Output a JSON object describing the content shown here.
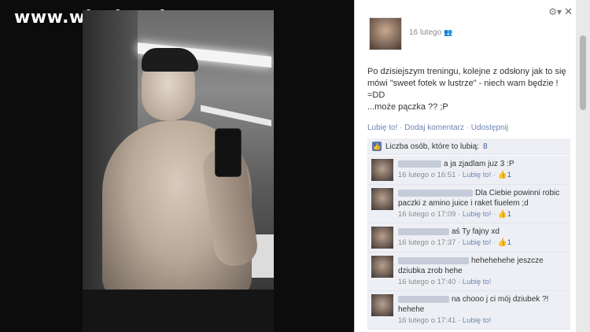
{
  "watermark": "www.wiocha.pl",
  "post": {
    "date": "16 lutego",
    "text_lines": [
      "Po dzisiejszym treningu, kolejne z odsłony jak to się",
      "mówi \"sweet fotek w lustrze\" - niech wam będzie !",
      "=DD",
      "...może pączka ?? ;P"
    ],
    "actions": {
      "like": "Lubię to!",
      "comment": "Dodaj komentarz",
      "share": "Udostępnij",
      "sep": "·"
    },
    "likes_label": "Liczba osób, które to lubią:",
    "likes_count": "8"
  },
  "comments": [
    {
      "text": "a ja zjadlam juz 3 :P",
      "time": "16 lutego o 16:51",
      "like": "Lubię to!",
      "likes": "1",
      "name_w": 55
    },
    {
      "text": "Dla Ciebie powinni robic paczki z amino juice i raket fiuelem ;d",
      "time": "16 lutego o 17:09",
      "like": "Lubię to!",
      "likes": "1",
      "name_w": 95
    },
    {
      "text": "aś Ty fajny xd",
      "time": "16 lutego o 17:37",
      "like": "Lubię to!",
      "likes": "1",
      "name_w": 65
    },
    {
      "text": "hehehehehe jeszcze dziubka zrob hehe",
      "time": "16 lutego o 17:40",
      "like": "Lubię to!",
      "likes": "",
      "name_w": 90
    },
    {
      "text": "na chooo j ci mój dziubek ?! hehehe",
      "time": "16 lutego o 17:41",
      "like": "Lubię to!",
      "likes": "",
      "name_w": 65
    }
  ],
  "ui": {
    "gear_icon": "gear-icon",
    "close_icon": "close-icon"
  }
}
